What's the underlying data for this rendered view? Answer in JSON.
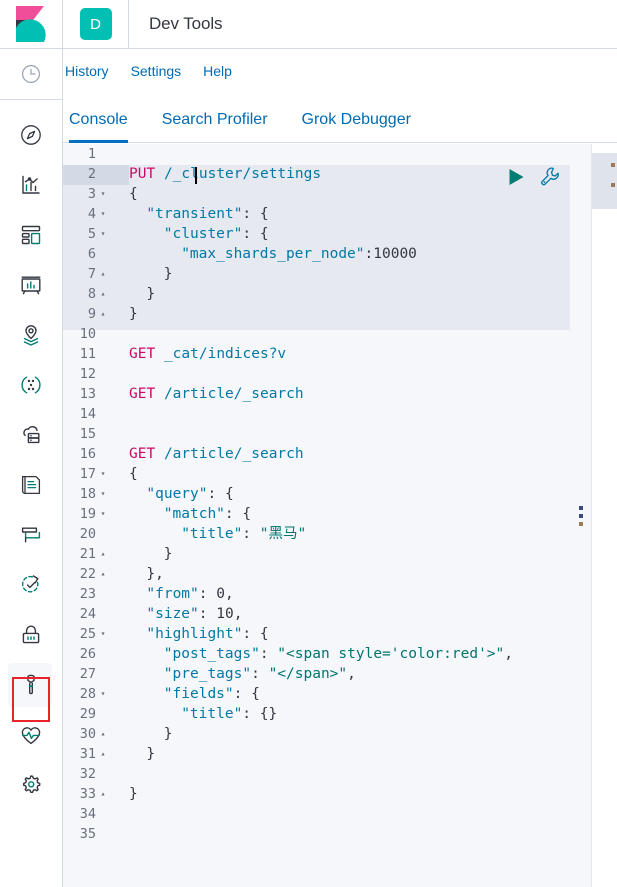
{
  "header": {
    "logo_icon": "kibana-logo",
    "space_initial": "D",
    "app_title": "Dev Tools"
  },
  "sidebar": {
    "recent_icon": "clock-icon",
    "items": [
      {
        "icon": "compass-discover-icon",
        "name": "discover"
      },
      {
        "icon": "bar-chart-visualize-icon",
        "name": "visualize"
      },
      {
        "icon": "dashboard-grid-icon",
        "name": "dashboard"
      },
      {
        "icon": "canvas-presentation-icon",
        "name": "canvas"
      },
      {
        "icon": "maps-location-layers-icon",
        "name": "maps"
      },
      {
        "icon": "machine-learning-nodes-icon",
        "name": "machine-learning"
      },
      {
        "icon": "infrastructure-cloud-server-icon",
        "name": "infrastructure"
      },
      {
        "icon": "logs-document-icon",
        "name": "logs"
      },
      {
        "icon": "apm-window-icon",
        "name": "apm"
      },
      {
        "icon": "uptime-check-arrow-icon",
        "name": "uptime"
      },
      {
        "icon": "security-lock-icon",
        "name": "siem"
      },
      {
        "icon": "wrench-dev-tools-icon",
        "name": "dev-tools"
      },
      {
        "icon": "heartbeat-monitoring-icon",
        "name": "stack-monitoring"
      },
      {
        "icon": "gear-management-icon",
        "name": "management"
      }
    ],
    "active_item": "dev-tools"
  },
  "nav_links": [
    {
      "label": "History"
    },
    {
      "label": "Settings"
    },
    {
      "label": "Help"
    }
  ],
  "tabs": [
    {
      "label": "Console",
      "active": true
    },
    {
      "label": "Search Profiler",
      "active": false
    },
    {
      "label": "Grok Debugger",
      "active": false
    }
  ],
  "console": {
    "play_button_label": "Click to send request",
    "wrench_button_label": "Open documentation / auto indent",
    "play_icon": "play-triangle-icon",
    "wrench_icon": "wrench-icon",
    "resizer_icon": "vertical-grip-dots-icon",
    "cursor_line": 2,
    "active_line": 2,
    "selected_request_lines": [
      2,
      9
    ],
    "accent_color": "#0071c2",
    "method_color": "#c80a68",
    "string_color": "#00756e",
    "key_color": "#0079a5",
    "play_color": "#017d73",
    "annotation_color": "#e8232a",
    "lines": [
      {
        "n": "1",
        "fold": "",
        "text": ""
      },
      {
        "n": "2",
        "fold": "",
        "text": "PUT /_cluster/settings"
      },
      {
        "n": "3",
        "fold": "▾",
        "text": "{"
      },
      {
        "n": "4",
        "fold": "▾",
        "text": "  \"transient\": {"
      },
      {
        "n": "5",
        "fold": "▾",
        "text": "    \"cluster\": {"
      },
      {
        "n": "6",
        "fold": "",
        "text": "      \"max_shards_per_node\":10000"
      },
      {
        "n": "7",
        "fold": "▴",
        "text": "    }"
      },
      {
        "n": "8",
        "fold": "▴",
        "text": "  }"
      },
      {
        "n": "9",
        "fold": "▴",
        "text": "}"
      },
      {
        "n": "10",
        "fold": "",
        "text": ""
      },
      {
        "n": "11",
        "fold": "",
        "text": "GET _cat/indices?v"
      },
      {
        "n": "12",
        "fold": "",
        "text": ""
      },
      {
        "n": "13",
        "fold": "",
        "text": "GET /article/_search"
      },
      {
        "n": "14",
        "fold": "",
        "text": ""
      },
      {
        "n": "15",
        "fold": "",
        "text": ""
      },
      {
        "n": "16",
        "fold": "",
        "text": "GET /article/_search"
      },
      {
        "n": "17",
        "fold": "▾",
        "text": "{"
      },
      {
        "n": "18",
        "fold": "▾",
        "text": "  \"query\": {"
      },
      {
        "n": "19",
        "fold": "▾",
        "text": "    \"match\": {"
      },
      {
        "n": "20",
        "fold": "",
        "text": "      \"title\": \"黑马\""
      },
      {
        "n": "21",
        "fold": "▴",
        "text": "    }"
      },
      {
        "n": "22",
        "fold": "▴",
        "text": "  },"
      },
      {
        "n": "23",
        "fold": "",
        "text": "  \"from\": 0,"
      },
      {
        "n": "24",
        "fold": "",
        "text": "  \"size\": 10,"
      },
      {
        "n": "25",
        "fold": "▾",
        "text": "  \"highlight\": {"
      },
      {
        "n": "26",
        "fold": "",
        "text": "    \"post_tags\": \"<span style='color:red'>\","
      },
      {
        "n": "27",
        "fold": "",
        "text": "    \"pre_tags\": \"</span>\","
      },
      {
        "n": "28",
        "fold": "▾",
        "text": "    \"fields\": {"
      },
      {
        "n": "29",
        "fold": "",
        "text": "      \"title\": {}"
      },
      {
        "n": "30",
        "fold": "▴",
        "text": "    }"
      },
      {
        "n": "31",
        "fold": "▴",
        "text": "  }"
      },
      {
        "n": "32",
        "fold": "",
        "text": ""
      },
      {
        "n": "33",
        "fold": "▴",
        "text": "}"
      },
      {
        "n": "34",
        "fold": "",
        "text": ""
      },
      {
        "n": "35",
        "fold": "",
        "text": ""
      }
    ]
  }
}
